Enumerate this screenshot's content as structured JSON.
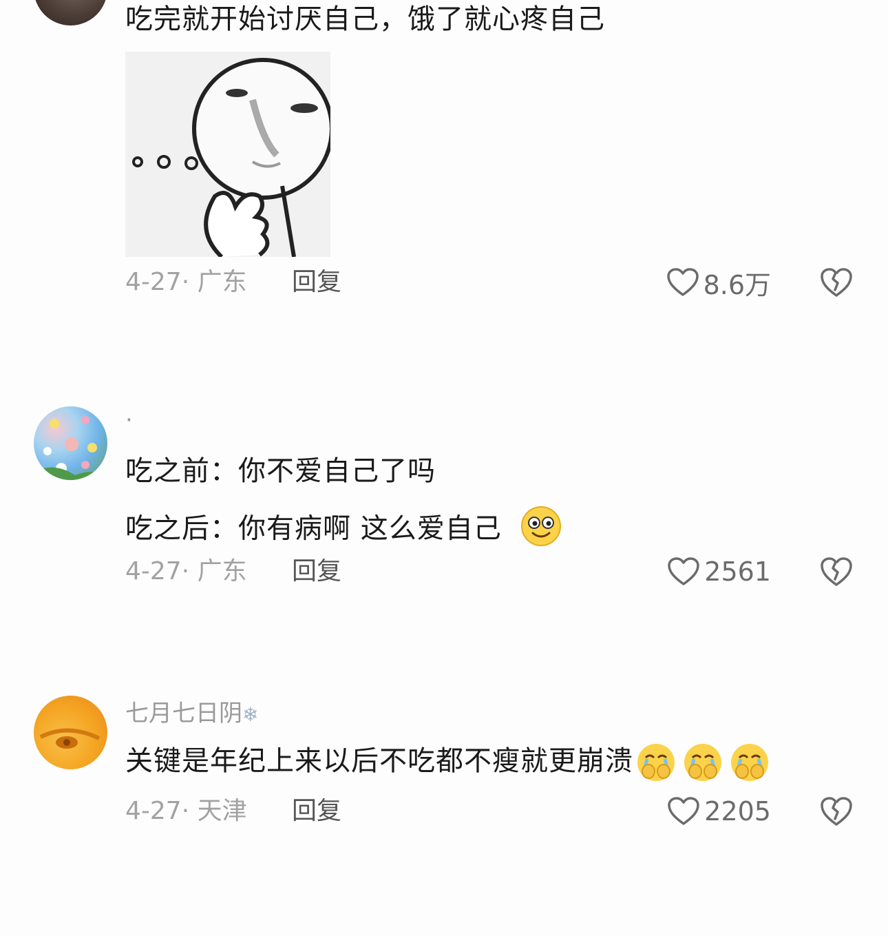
{
  "comments": [
    {
      "username": "",
      "lines": [
        "吃完就开始讨厌自己，饿了就心疼自己"
      ],
      "date_location": "4-27· 广东",
      "reply_label": "回复",
      "likes": "8.6万",
      "avatar_icon": "user-avatar"
    },
    {
      "username": "·",
      "lines": [
        "吃之前：你不爱自己了吗",
        "吃之后：你有病啊 这么爱自己"
      ],
      "date_location": "4-27· 广东",
      "reply_label": "回复",
      "likes": "2561",
      "avatar_icon": "flower-avatar",
      "emoji": "smile-emoji"
    },
    {
      "username": "七月七日阴",
      "username_suffix": "❄",
      "lines": [
        "关键是年纪上来以后不吃都不瘦就更崩溃"
      ],
      "date_location": "4-27· 天津",
      "reply_label": "回复",
      "likes": "2205",
      "avatar_icon": "eye-avatar",
      "emoji": "crying-emoji"
    }
  ],
  "colors": {
    "background": "#fdfdfd",
    "text": "#1a1a1a",
    "meta": "#a2a2a2",
    "icon": "#6b6b6b"
  }
}
